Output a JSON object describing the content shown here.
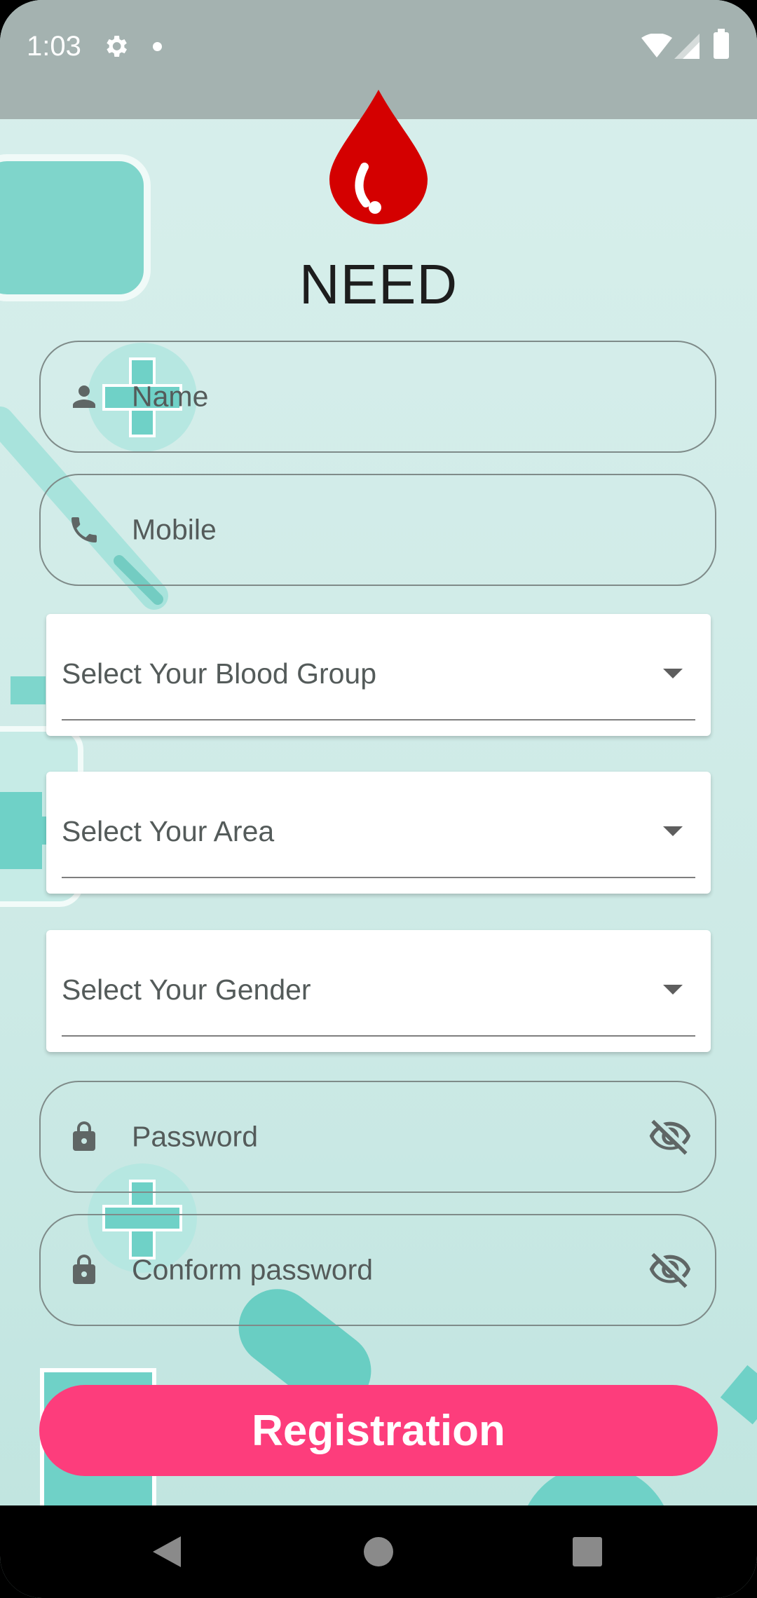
{
  "status_bar": {
    "time": "1:03",
    "icons": [
      "gear-icon",
      "notification-dot",
      "wifi-icon",
      "signal-icon",
      "battery-icon"
    ]
  },
  "app": {
    "title": "NEED",
    "logo_icon": "blood-drop-icon"
  },
  "form": {
    "name": {
      "placeholder": "Name",
      "icon": "person-icon"
    },
    "mobile": {
      "placeholder": "Mobile",
      "icon": "phone-icon"
    },
    "blood_group": {
      "label": "Select Your Blood Group"
    },
    "area": {
      "label": "Select Your Area"
    },
    "gender": {
      "label": "Select Your Gender"
    },
    "password": {
      "placeholder": "Password",
      "icon": "lock-icon",
      "toggle_icon": "eye-off-icon"
    },
    "confirm_password": {
      "placeholder": "Conform password",
      "icon": "lock-icon",
      "toggle_icon": "eye-off-icon"
    },
    "submit_label": "Registration"
  },
  "nav_bar": {
    "icons": [
      "back-icon",
      "home-icon",
      "recents-icon"
    ]
  },
  "colors": {
    "accent": "#fd3d7c",
    "blood": "#d40000",
    "background": "#d8efec",
    "teal": "#6fd1c7"
  }
}
